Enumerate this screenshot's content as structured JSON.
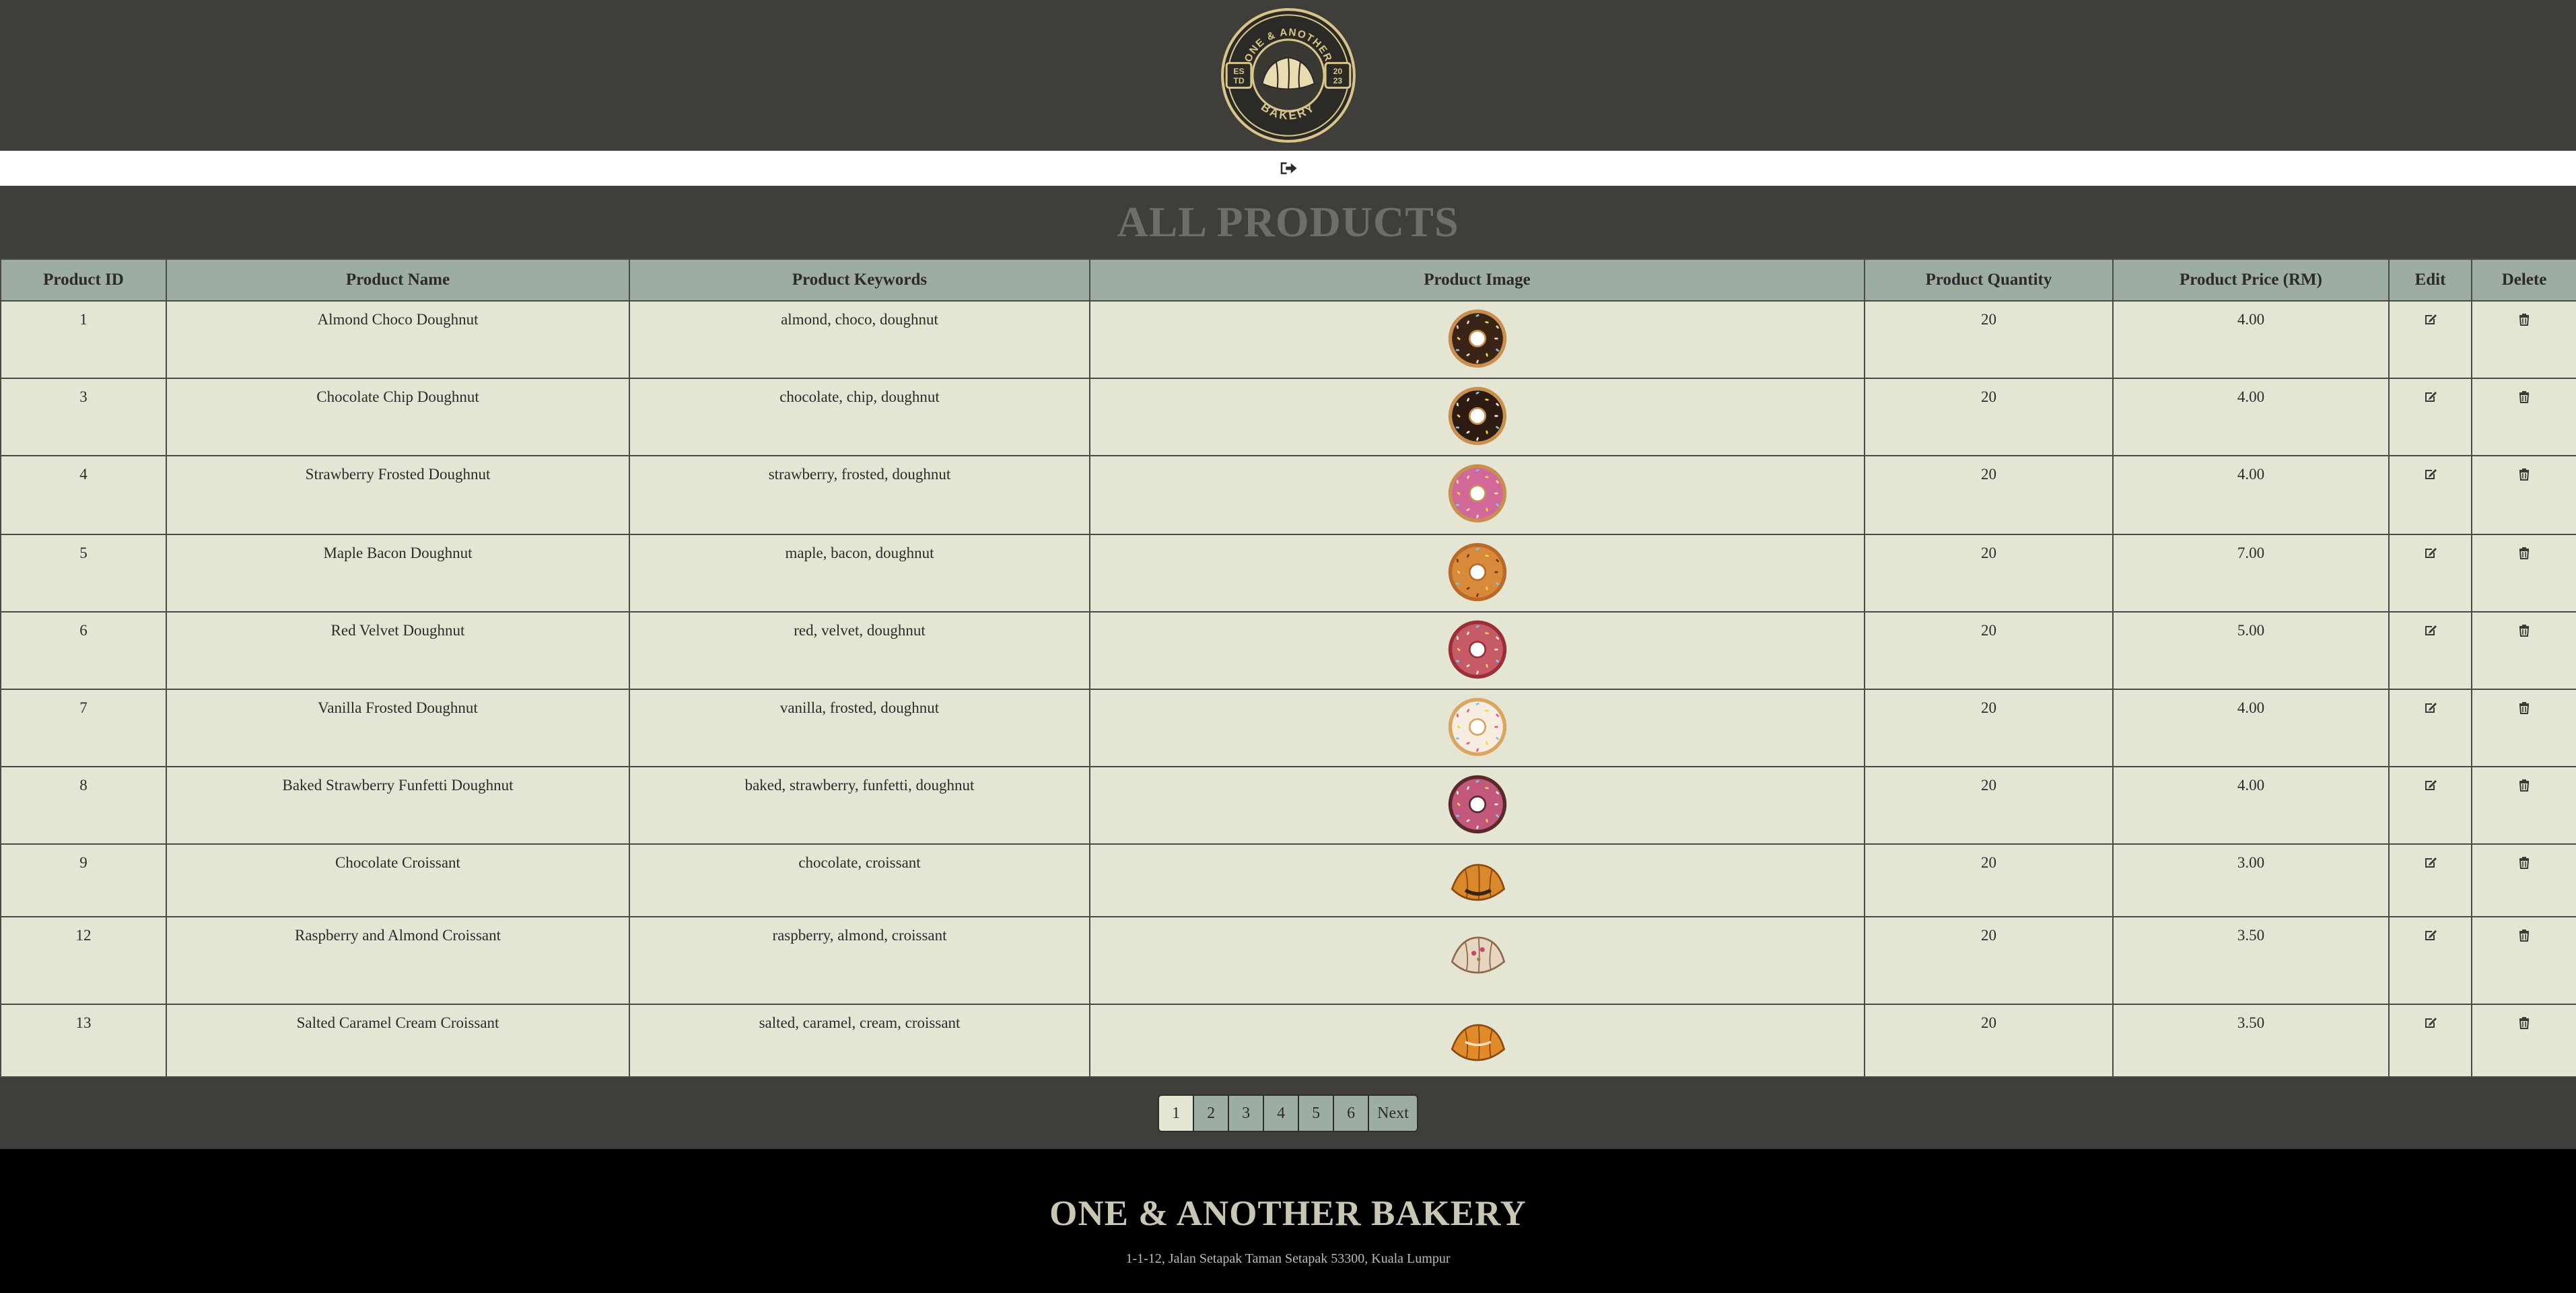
{
  "header": {
    "logo": {
      "top_text": "ONE & ANOTHER",
      "bottom_text": "BAKERY",
      "left_badge": [
        "ES",
        "TD"
      ],
      "right_badge": [
        "20",
        "23"
      ]
    }
  },
  "nav": {
    "logout_icon": "sign-out-icon"
  },
  "main": {
    "title": "ALL PRODUCTS",
    "columns": [
      "Product ID",
      "Product Name",
      "Product Keywords",
      "Product Image",
      "Product Quantity",
      "Product Price (RM)",
      "Edit",
      "Delete"
    ],
    "rows": [
      {
        "id": "1",
        "name": "Almond Choco Doughnut",
        "keywords": "almond, choco, doughnut",
        "image": "donut-choco-almond",
        "quantity": "20",
        "price": "4.00"
      },
      {
        "id": "3",
        "name": "Chocolate Chip Doughnut",
        "keywords": "chocolate, chip, doughnut",
        "image": "donut-chocolate-drizzle",
        "quantity": "20",
        "price": "4.00"
      },
      {
        "id": "4",
        "name": "Strawberry Frosted Doughnut",
        "keywords": "strawberry, frosted, doughnut",
        "image": "donut-pink-sprinkles",
        "quantity": "20",
        "price": "4.00"
      },
      {
        "id": "5",
        "name": "Maple Bacon Doughnut",
        "keywords": "maple, bacon, doughnut",
        "image": "donut-maple-bacon",
        "quantity": "20",
        "price": "7.00"
      },
      {
        "id": "6",
        "name": "Red Velvet Doughnut",
        "keywords": "red, velvet, doughnut",
        "image": "donut-red-velvet",
        "quantity": "20",
        "price": "5.00"
      },
      {
        "id": "7",
        "name": "Vanilla Frosted Doughnut",
        "keywords": "vanilla, frosted, doughnut",
        "image": "donut-vanilla-sprinkles",
        "quantity": "20",
        "price": "4.00"
      },
      {
        "id": "8",
        "name": "Baked Strawberry Funfetti Doughnut",
        "keywords": "baked, strawberry, funfetti, doughnut",
        "image": "donut-funfetti-drizzle",
        "quantity": "20",
        "price": "4.00"
      },
      {
        "id": "9",
        "name": "Chocolate Croissant",
        "keywords": "chocolate, croissant",
        "image": "croissant-chocolate",
        "quantity": "20",
        "price": "3.00"
      },
      {
        "id": "12",
        "name": "Raspberry and Almond Croissant",
        "keywords": "raspberry, almond, croissant",
        "image": "croissant-raspberry-almond",
        "quantity": "20",
        "price": "3.50"
      },
      {
        "id": "13",
        "name": "Salted Caramel Cream Croissant",
        "keywords": "salted, caramel, cream, croissant",
        "image": "croissant-salted-caramel",
        "quantity": "20",
        "price": "3.50"
      }
    ],
    "edit_icon": "edit-icon",
    "delete_icon": "trash-icon"
  },
  "pagination": {
    "pages": [
      "1",
      "2",
      "3",
      "4",
      "5",
      "6"
    ],
    "active": "1",
    "next_label": "Next"
  },
  "footer": {
    "title": "ONE & ANOTHER BAKERY",
    "address": "1-1-12, Jalan Setapak Taman Setapak 53300, Kuala Lumpur"
  },
  "colors": {
    "header_bg": "#403e3a",
    "table_header_bg": "#9dada2",
    "row_bg": "#e4e6d3",
    "footer_bg": "#000000",
    "logo_gold": "#d8c58a"
  }
}
